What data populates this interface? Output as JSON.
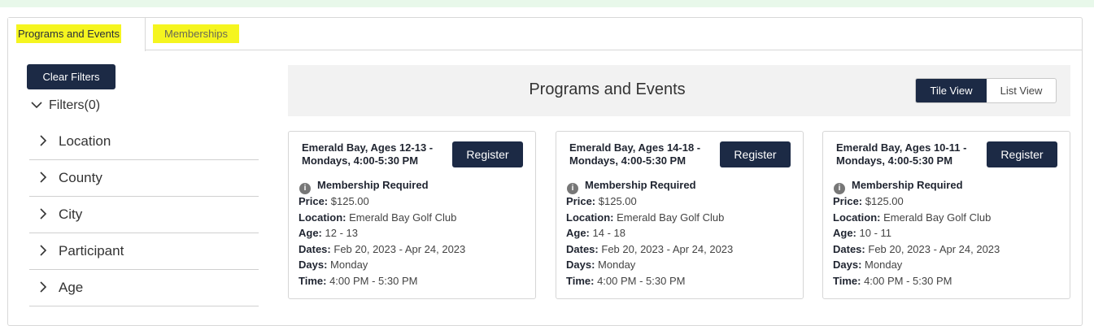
{
  "tabs": [
    {
      "label": "Programs and Events",
      "active": true
    },
    {
      "label": "Memberships",
      "active": false
    }
  ],
  "highlight_color": "#f5f51f",
  "sidebar": {
    "clear_label": "Clear Filters",
    "filters_label": "Filters(0)",
    "filters": [
      "Location",
      "County",
      "City",
      "Participant",
      "Age"
    ]
  },
  "main": {
    "title": "Programs and Events",
    "view_toggle": {
      "tile": "Tile View",
      "list": "List View",
      "selected": "Tile View"
    }
  },
  "cards": [
    {
      "title": "Emerald Bay, Ages 12-13 - Mondays, 4:00-5:30 PM",
      "register": "Register",
      "membership": "Membership Required",
      "price_label": "Price:",
      "price": "$125.00",
      "location_label": "Location:",
      "location": "Emerald Bay Golf Club",
      "age_label": "Age:",
      "age": "12 - 13",
      "dates_label": "Dates:",
      "dates": "Feb 20, 2023 - Apr 24, 2023",
      "days_label": "Days:",
      "days": "Monday",
      "time_label": "Time:",
      "time": "4:00 PM - 5:30 PM"
    },
    {
      "title": "Emerald Bay, Ages 14-18 - Mondays, 4:00-5:30 PM",
      "register": "Register",
      "membership": "Membership Required",
      "price_label": "Price:",
      "price": "$125.00",
      "location_label": "Location:",
      "location": "Emerald Bay Golf Club",
      "age_label": "Age:",
      "age": "14 - 18",
      "dates_label": "Dates:",
      "dates": "Feb 20, 2023 - Apr 24, 2023",
      "days_label": "Days:",
      "days": "Monday",
      "time_label": "Time:",
      "time": "4:00 PM - 5:30 PM"
    },
    {
      "title": "Emerald Bay, Ages 10-11 - Mondays, 4:00-5:30 PM",
      "register": "Register",
      "membership": "Membership Required",
      "price_label": "Price:",
      "price": "$125.00",
      "location_label": "Location:",
      "location": "Emerald Bay Golf Club",
      "age_label": "Age:",
      "age": "10 - 11",
      "dates_label": "Dates:",
      "dates": "Feb 20, 2023 - Apr 24, 2023",
      "days_label": "Days:",
      "days": "Monday",
      "time_label": "Time:",
      "time": "4:00 PM - 5:30 PM"
    }
  ],
  "colors": {
    "primary": "#1c2a45",
    "header_bg": "#f2f2f2",
    "top_band": "#e8f8ea"
  },
  "icons": {
    "filter_chevron": "chevron-right-icon",
    "filters_toggle": "chevron-down-icon",
    "membership": "info-icon"
  }
}
